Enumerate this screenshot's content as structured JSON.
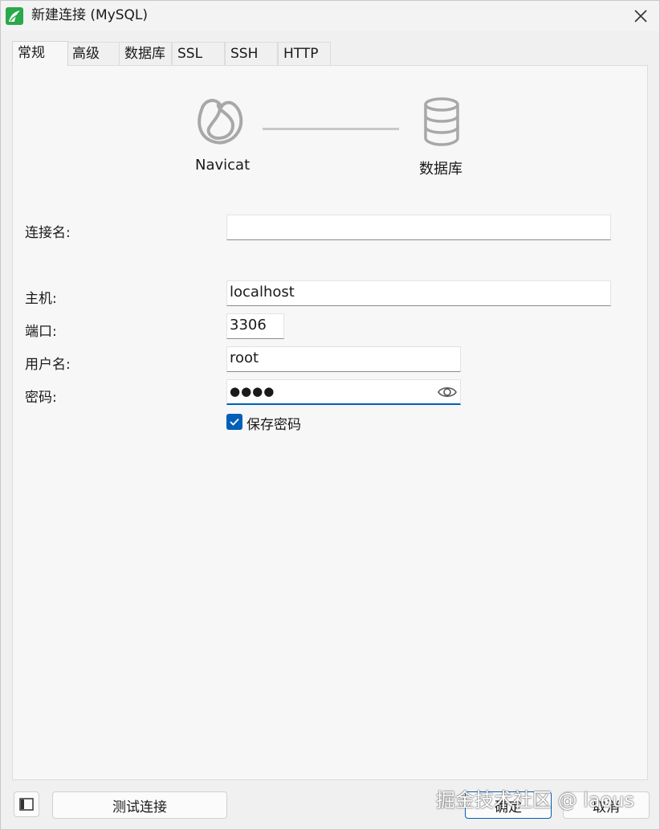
{
  "window": {
    "title": "新建连接 (MySQL)"
  },
  "tabs": [
    {
      "label": "常规",
      "active": true
    },
    {
      "label": "高级",
      "active": false
    },
    {
      "label": "数据库",
      "active": false
    },
    {
      "label": "SSL",
      "active": false
    },
    {
      "label": "SSH",
      "active": false
    },
    {
      "label": "HTTP",
      "active": false
    }
  ],
  "flow": {
    "source_label": "Navicat",
    "target_label": "数据库"
  },
  "form": {
    "connection_name": {
      "label": "连接名:",
      "value": ""
    },
    "host": {
      "label": "主机:",
      "value": "localhost"
    },
    "port": {
      "label": "端口:",
      "value": "3306"
    },
    "username": {
      "label": "用户名:",
      "value": "root"
    },
    "password": {
      "label": "密码:",
      "value": "●●●●"
    },
    "save_password": {
      "label": "保存密码",
      "checked": true
    }
  },
  "buttons": {
    "test": "测试连接",
    "ok": "确定",
    "cancel": "取消"
  },
  "watermark": "掘金技术社区 @ laous",
  "colors": {
    "accent": "#005fb8",
    "brand": "#2aa84a",
    "panel": "#f7f7f7"
  },
  "icons": [
    "navicat-logo-icon",
    "close-icon",
    "navicat-icon",
    "database-icon",
    "eye-icon",
    "checkmark-icon",
    "sidebar-toggle-icon"
  ]
}
